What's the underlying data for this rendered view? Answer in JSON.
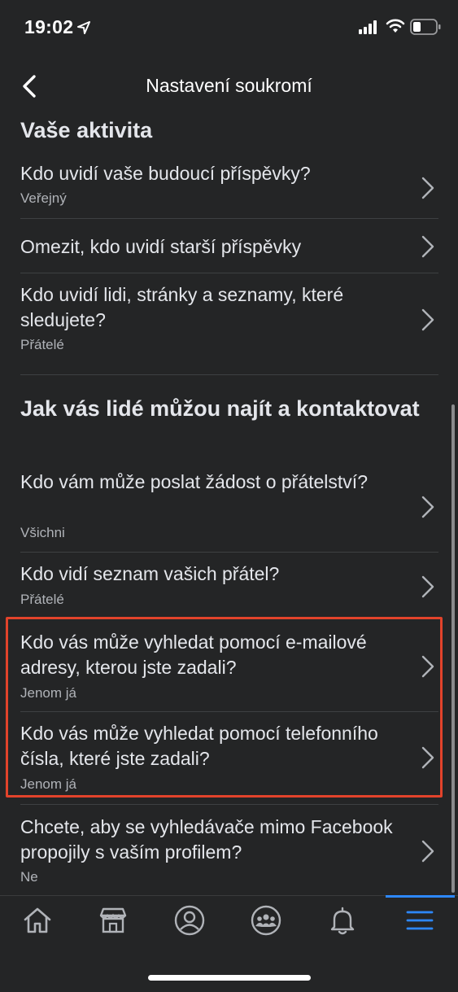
{
  "status_bar": {
    "time": "19:02"
  },
  "header": {
    "title": "Nastavení soukromí"
  },
  "sections": [
    {
      "title": "Vaše aktivita"
    },
    {
      "title": "Jak vás lidé můžou najít a kontaktovat"
    }
  ],
  "rows": [
    {
      "title": "Kdo uvidí vaše budoucí příspěvky?",
      "subtitle": "Veřejný"
    },
    {
      "title": "Omezit, kdo uvidí starší příspěvky"
    },
    {
      "title": "Kdo uvidí lidi, stránky a seznamy, které sledujete?",
      "subtitle": "Přátelé"
    },
    {
      "title": "Kdo vám může poslat žádost o přátelství?",
      "subtitle": "Všichni"
    },
    {
      "title": "Kdo vidí seznam vašich přátel?",
      "subtitle": "Přátelé"
    },
    {
      "title": "Kdo vás může vyhledat pomocí e-mailové adresy, kterou jste zadali?",
      "subtitle": "Jenom já"
    },
    {
      "title": "Kdo vás může vyhledat pomocí telefonního čísla, které jste zadali?",
      "subtitle": "Jenom já"
    },
    {
      "title": "Chcete, aby se vyhledávače mimo Facebook propojily s vaším profilem?",
      "subtitle": "Ne"
    }
  ],
  "tabs": [
    {
      "icon": "home-icon"
    },
    {
      "icon": "marketplace-icon"
    },
    {
      "icon": "profile-icon"
    },
    {
      "icon": "groups-icon"
    },
    {
      "icon": "notifications-icon"
    },
    {
      "icon": "menu-icon",
      "active": true
    }
  ],
  "colors": {
    "background": "#242526",
    "accent": "#2d88ff",
    "highlight": "#e2432b",
    "text_primary": "#e4e6eb",
    "text_secondary": "#b0b3b8"
  }
}
